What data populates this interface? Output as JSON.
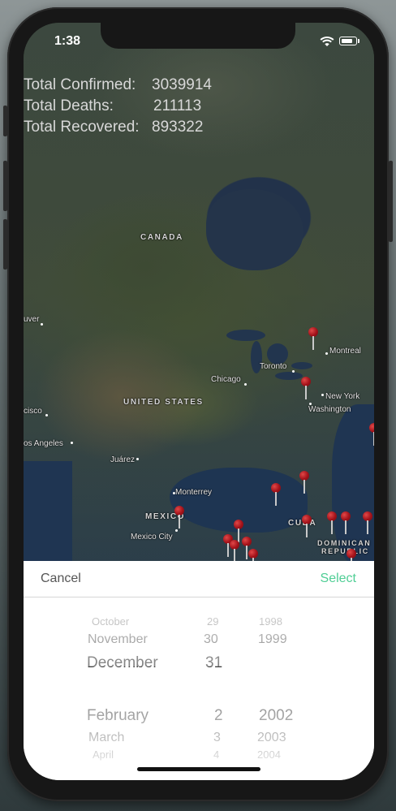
{
  "status_bar": {
    "time": "1:38"
  },
  "stats": {
    "confirmed_label": "Total Confirmed:",
    "confirmed_value": "3039914",
    "deaths_label": "Total Deaths:",
    "deaths_value": "211113",
    "recovered_label": "Total Recovered:",
    "recovered_value": "893322"
  },
  "map": {
    "labels": {
      "canada": "CANADA",
      "united_states": "UNITED STATES",
      "mexico": "MEXICO",
      "cuba": "CUBA",
      "dominican_republic_1": "DOMINICAN",
      "dominican_republic_2": "REPUBLIC",
      "montreal": "Montreal",
      "toronto": "Toronto",
      "chicago": "Chicago",
      "new_york": "New York",
      "washington": "Washington",
      "juarez": "Juárez",
      "monterrey": "Monterrey",
      "mexico_city": "Mexico City",
      "los_angeles": "os Angeles",
      "san_francisco": "cisco",
      "vancouver": "uver"
    },
    "pin_color": "#a3121a"
  },
  "picker": {
    "cancel_label": "Cancel",
    "select_label": "Select",
    "select_color": "#4fce95",
    "months": [
      "October",
      "November",
      "December",
      "February",
      "March",
      "April"
    ],
    "days": [
      "29",
      "30",
      "31",
      "2",
      "3",
      "4"
    ],
    "years": [
      "1998",
      "1999",
      "2002",
      "2003",
      "2004"
    ]
  }
}
